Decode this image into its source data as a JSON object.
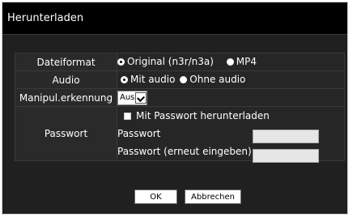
{
  "dialog": {
    "title": "Herunterladen"
  },
  "form": {
    "dateiformat": {
      "label": "Dateiformat",
      "options": [
        {
          "label": "Original (n3r/n3a)",
          "selected": true
        },
        {
          "label": "MP4",
          "selected": false
        }
      ]
    },
    "audio": {
      "label": "Audio",
      "options": [
        {
          "label": "Mit audio",
          "selected": true
        },
        {
          "label": "Ohne audio",
          "selected": false
        }
      ]
    },
    "manipulation": {
      "label": "Manipul.erkennung",
      "selected": "Aus"
    },
    "passwort": {
      "label": "Passwort",
      "checkbox_label": "Mit Passwort herunterladen",
      "checked": false,
      "password_label": "Passwort",
      "password_value": "",
      "confirm_label": "Passwort (erneut eingeben)",
      "confirm_value": ""
    }
  },
  "buttons": {
    "ok": "OK",
    "cancel": "Abbrechen"
  },
  "colors": {
    "background": "#202020",
    "titlebar": "#000000",
    "text": "#ffffff",
    "input_fill": "#e6e6e6"
  }
}
